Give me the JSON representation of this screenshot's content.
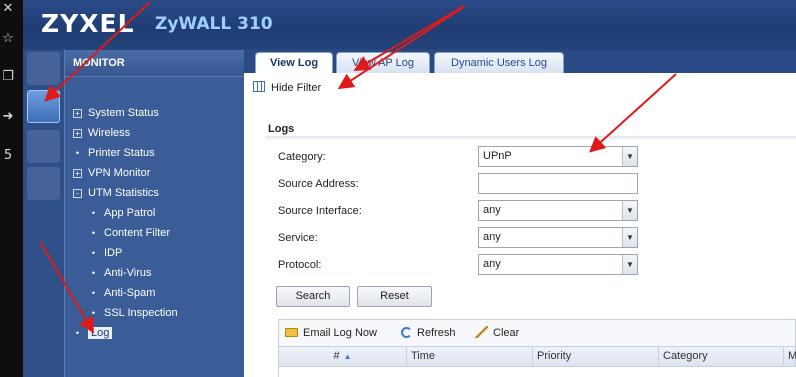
{
  "os_strip": {
    "icons": [
      "close-icon",
      "star-icon",
      "copy-icon",
      "forward-icon",
      "number-icon"
    ]
  },
  "header": {
    "brand": "ZYXEL",
    "model": "ZyWALL 310"
  },
  "side_icons": [
    "dashboard-icon",
    "monitor-icon",
    "gear-icon",
    "maintenance-icon"
  ],
  "monitor": {
    "title": "MONITOR",
    "items": [
      {
        "label": "System Status",
        "marker": "+"
      },
      {
        "label": "Wireless",
        "marker": "+"
      },
      {
        "label": "Printer Status",
        "marker": "•"
      },
      {
        "label": "VPN Monitor",
        "marker": "+"
      },
      {
        "label": "UTM Statistics",
        "marker": "-"
      },
      {
        "label": "App Patrol",
        "marker": "•"
      },
      {
        "label": "Content Filter",
        "marker": "•"
      },
      {
        "label": "IDP",
        "marker": "•"
      },
      {
        "label": "Anti-Virus",
        "marker": "•"
      },
      {
        "label": "Anti-Spam",
        "marker": "•"
      },
      {
        "label": "SSL Inspection",
        "marker": "•"
      },
      {
        "label": "Log",
        "marker": "•"
      }
    ]
  },
  "tabs": [
    "View Log",
    "View AP Log",
    "Dynamic Users Log"
  ],
  "toolbar": {
    "hide_filter": "Hide Filter"
  },
  "logs": {
    "section_title": "Logs",
    "fields": {
      "category": {
        "label": "Category:",
        "value": "UPnP"
      },
      "source_address": {
        "label": "Source Address:",
        "value": ""
      },
      "source_interface": {
        "label": "Source Interface:",
        "value": "any"
      },
      "service": {
        "label": "Service:",
        "value": "any"
      },
      "protocol": {
        "label": "Protocol:",
        "value": "any"
      }
    },
    "buttons": {
      "search": "Search",
      "reset": "Reset"
    },
    "table_toolbar": {
      "email": "Email Log Now",
      "refresh": "Refresh",
      "clear": "Clear"
    },
    "columns": [
      "#",
      "Time",
      "Priority",
      "Category",
      "M"
    ]
  },
  "colors": {
    "header_blue": "#2a4b87",
    "panel_blue": "#3b5d97",
    "arrow_red": "#e01a1a"
  }
}
